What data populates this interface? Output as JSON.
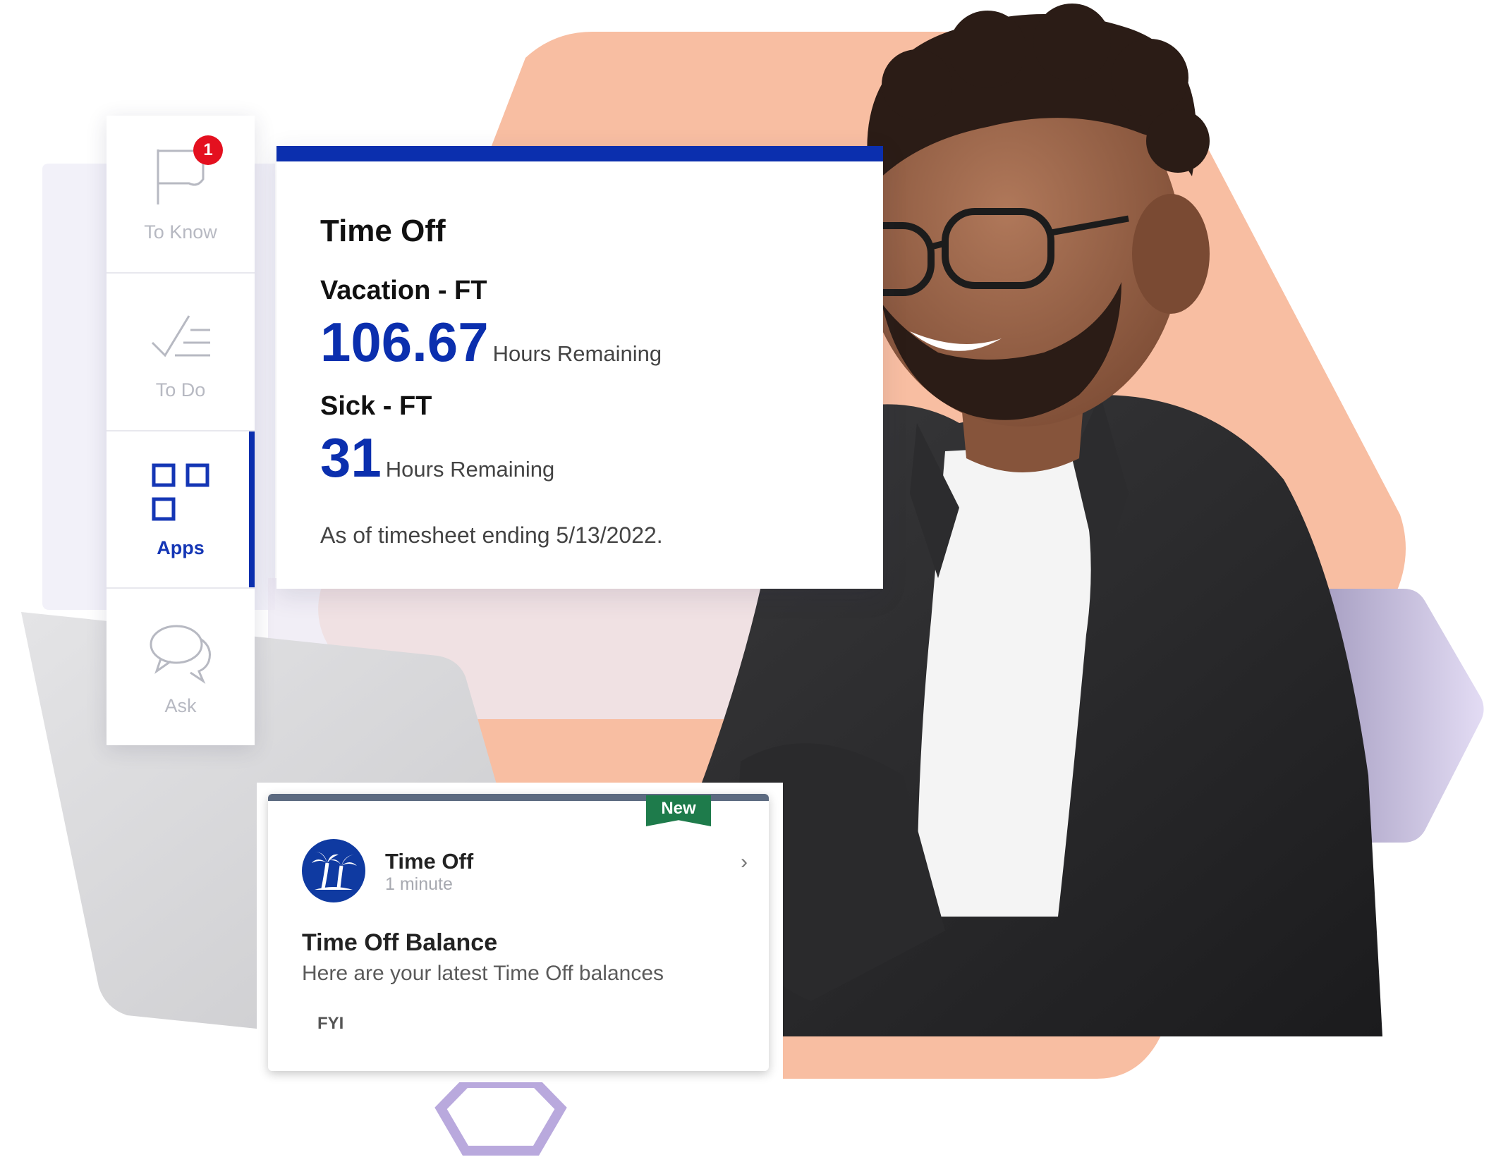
{
  "colors": {
    "brand_blue": "#0b2fae",
    "badge_red": "#e4101f",
    "new_green": "#1e7b4b",
    "peach": "#f8bea2",
    "lavender": "#ddd5f0"
  },
  "sidebar": {
    "items": [
      {
        "label": "To Know",
        "icon": "flag-icon",
        "badge": "1",
        "active": false
      },
      {
        "label": "To Do",
        "icon": "checklist-icon",
        "active": false
      },
      {
        "label": "Apps",
        "icon": "apps-grid-icon",
        "active": true
      },
      {
        "label": "Ask",
        "icon": "chat-bubbles-icon",
        "active": false
      }
    ]
  },
  "time_off_card": {
    "title": "Time Off",
    "balances": [
      {
        "plan": "Vacation - FT",
        "hours": "106.67",
        "unit": "Hours Remaining"
      },
      {
        "plan": "Sick - FT",
        "hours": "31",
        "unit": "Hours Remaining"
      }
    ],
    "as_of": "As of timesheet ending 5/13/2022."
  },
  "notification": {
    "badge": "New",
    "app_icon": "palm-trees-icon",
    "app_name": "Time Off",
    "time_ago": "1 minute",
    "title": "Time Off Balance",
    "body": "Here are your latest Time Off balances",
    "tag": "FYI"
  }
}
